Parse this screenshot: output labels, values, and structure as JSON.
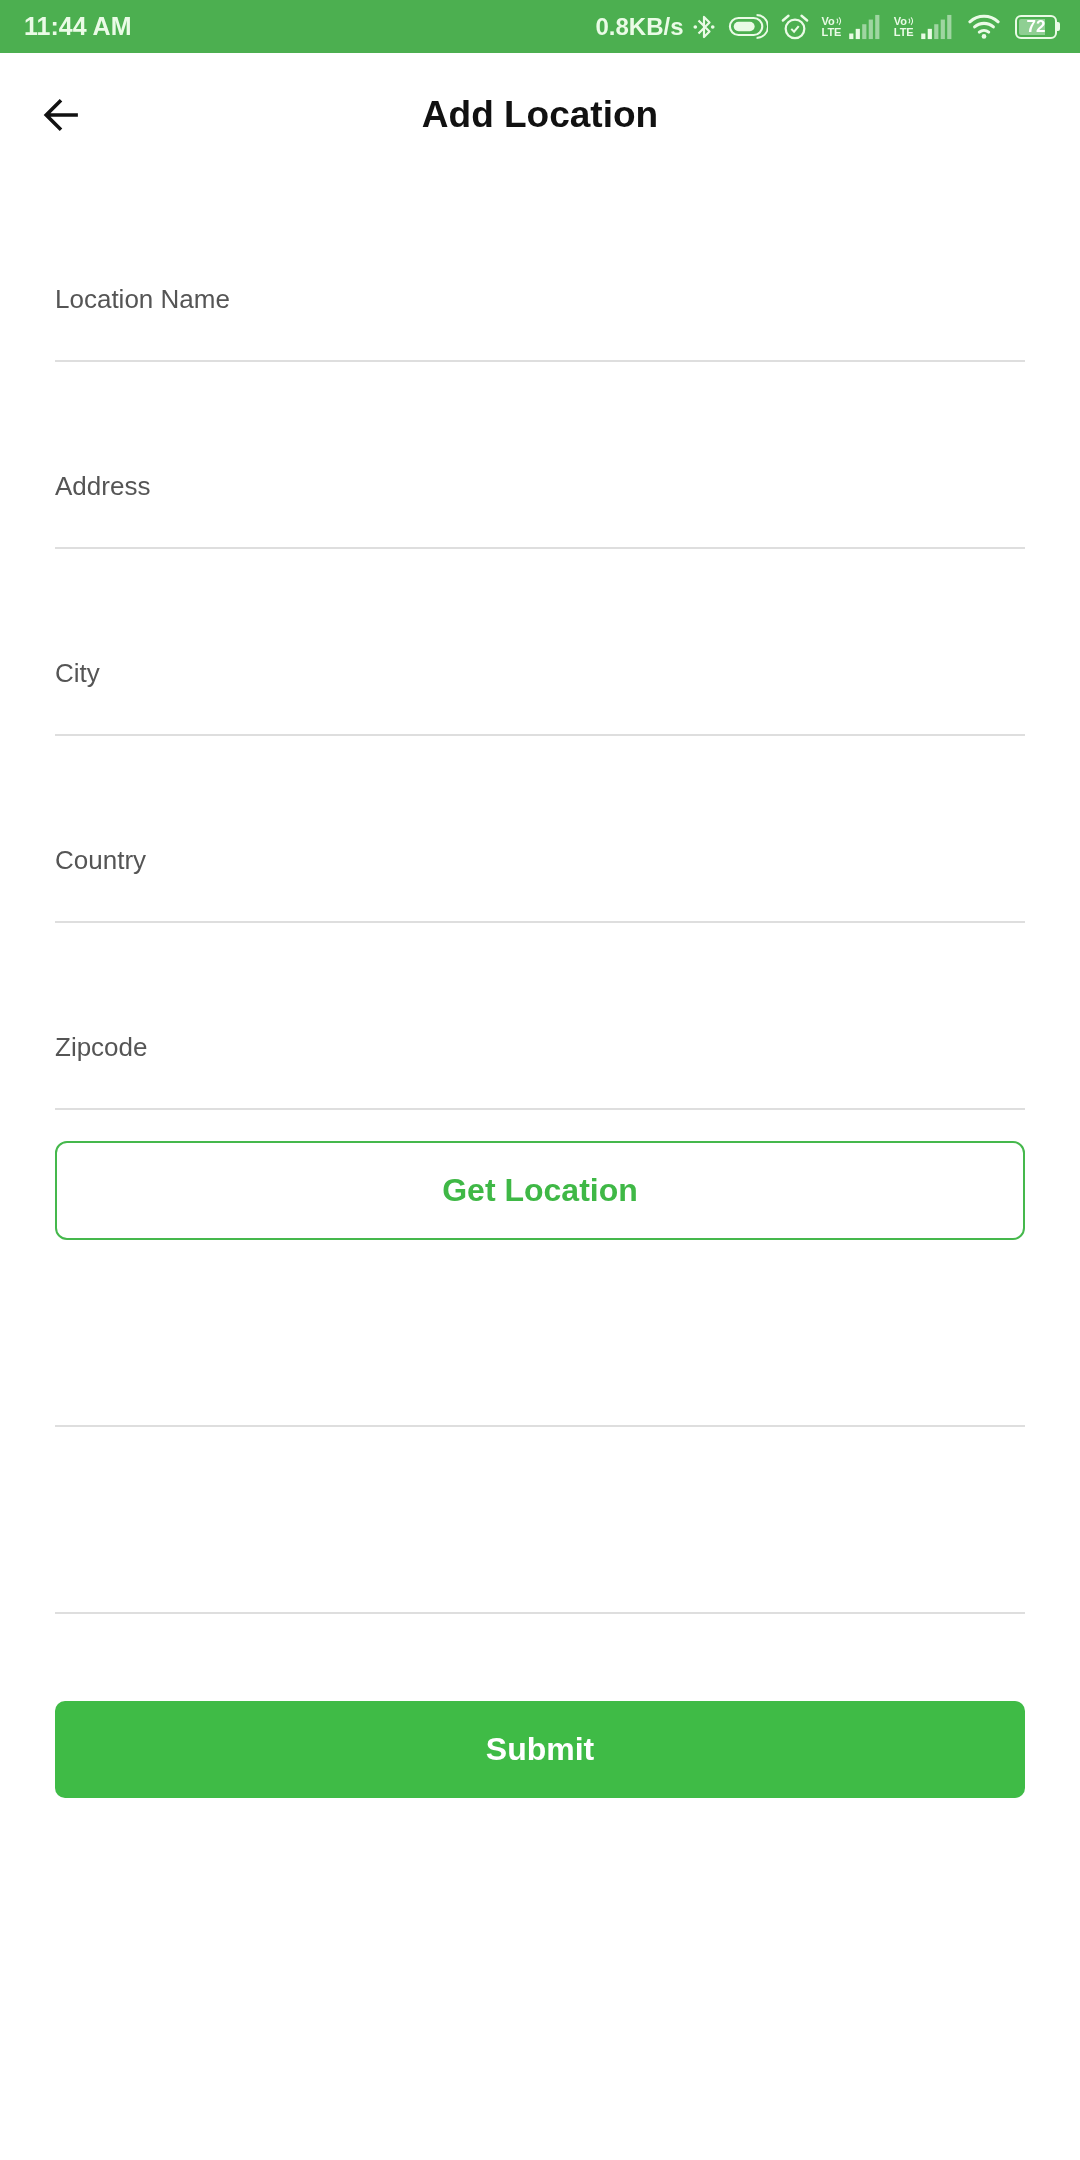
{
  "status_bar": {
    "time": "11:44 AM",
    "net_speed": "0.8KB/s",
    "sims": [
      {
        "volte": "Vo",
        "network": "LTE"
      },
      {
        "volte": "Vo",
        "network": "LTE"
      }
    ],
    "battery": "72"
  },
  "header": {
    "title": "Add Location"
  },
  "form": [
    {
      "kind": "field",
      "placeholder": "Location Name"
    },
    {
      "kind": "field",
      "placeholder": "Address"
    },
    {
      "kind": "field",
      "placeholder": "City"
    },
    {
      "kind": "field",
      "placeholder": "Country"
    },
    {
      "kind": "field",
      "placeholder": "Zipcode"
    },
    {
      "kind": "outline_button",
      "label": "Get Location"
    },
    {
      "kind": "field"
    },
    {
      "kind": "field"
    }
  ],
  "submit": {
    "label": "Submit"
  }
}
